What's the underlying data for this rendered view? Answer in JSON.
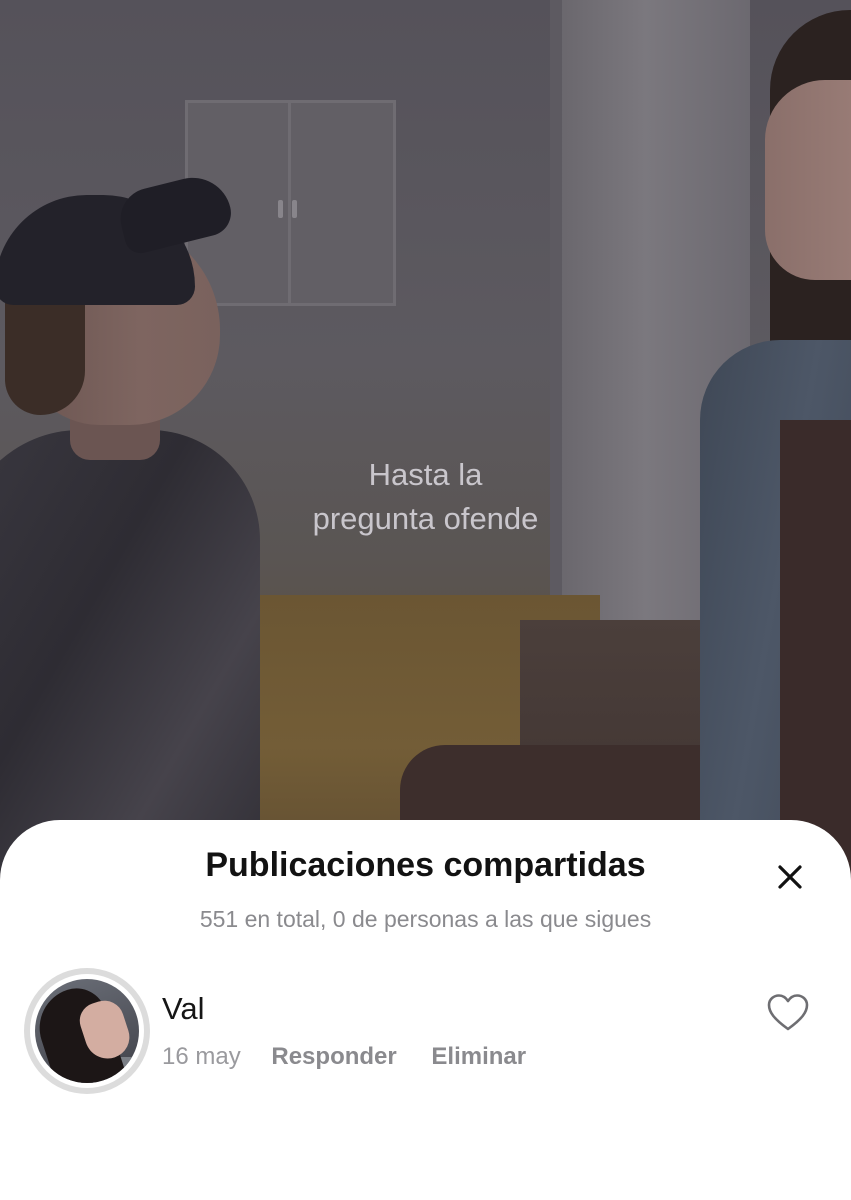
{
  "video": {
    "caption_line1": "Hasta la",
    "caption_line2": "pregunta ofende"
  },
  "sheet": {
    "title": "Publicaciones compartidas",
    "subtitle": "551 en total, 0 de personas a las que sigues",
    "close_icon": "close-icon"
  },
  "comments": [
    {
      "username": "Val",
      "date": "16 may",
      "reply_label": "Responder",
      "delete_label": "Eliminar",
      "like_icon": "heart-outline-icon"
    }
  ],
  "colors": {
    "sheet_background": "#ffffff",
    "title_text": "#121212",
    "secondary_text": "#8a8a8e"
  }
}
